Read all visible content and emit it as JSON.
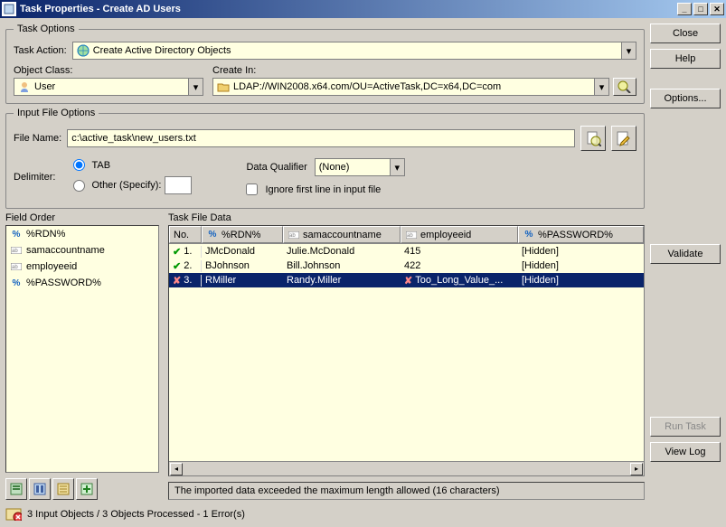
{
  "window": {
    "title": "Task Properties - Create AD Users"
  },
  "buttons": {
    "close": "Close",
    "help": "Help",
    "options": "Options...",
    "validate": "Validate",
    "run_task": "Run Task",
    "view_log": "View Log"
  },
  "task_options": {
    "legend": "Task Options",
    "action_label": "Task Action:",
    "action_value": "Create Active Directory Objects",
    "object_class_label": "Object Class:",
    "object_class_value": "User",
    "create_in_label": "Create In:",
    "create_in_value": "LDAP://WIN2008.x64.com/OU=ActiveTask,DC=x64,DC=com"
  },
  "input_file_options": {
    "legend": "Input File Options",
    "file_name_label": "File Name:",
    "file_name_value": "c:\\active_task\\new_users.txt",
    "delimiter_label": "Delimiter:",
    "radio_tab": "TAB",
    "radio_other": "Other (Specify):",
    "data_qualifier_label": "Data Qualifier",
    "data_qualifier_value": "(None)",
    "ignore_first_line": "Ignore first line in input file"
  },
  "field_order": {
    "legend": "Field Order",
    "items": [
      {
        "icon": "pct",
        "label": "%RDN%"
      },
      {
        "icon": "txt",
        "label": "samaccountname"
      },
      {
        "icon": "txt",
        "label": "employeeid"
      },
      {
        "icon": "pct",
        "label": "%PASSWORD%"
      }
    ]
  },
  "task_file_data": {
    "legend": "Task File Data",
    "columns": {
      "no": "No.",
      "rdn": "%RDN%",
      "sam": "samaccountname",
      "emp": "employeeid",
      "pw": "%PASSWORD%"
    },
    "rows": [
      {
        "status": "ok",
        "no": "1.",
        "rdn": "JMcDonald",
        "sam": "Julie.McDonald",
        "emp": "415",
        "pw": "[Hidden]",
        "emp_err": false
      },
      {
        "status": "ok",
        "no": "2.",
        "rdn": "BJohnson",
        "sam": "Bill.Johnson",
        "emp": "422",
        "pw": "[Hidden]",
        "emp_err": false
      },
      {
        "status": "err",
        "no": "3.",
        "rdn": "RMiller",
        "sam": "Randy.Miller",
        "emp": "Too_Long_Value_...",
        "pw": "[Hidden]",
        "emp_err": true
      }
    ],
    "validation_msg": "The imported data exceeded the maximum length allowed (16 characters)"
  },
  "status_bar": {
    "text": "3 Input Objects / 3 Objects Processed - 1 Error(s)"
  }
}
